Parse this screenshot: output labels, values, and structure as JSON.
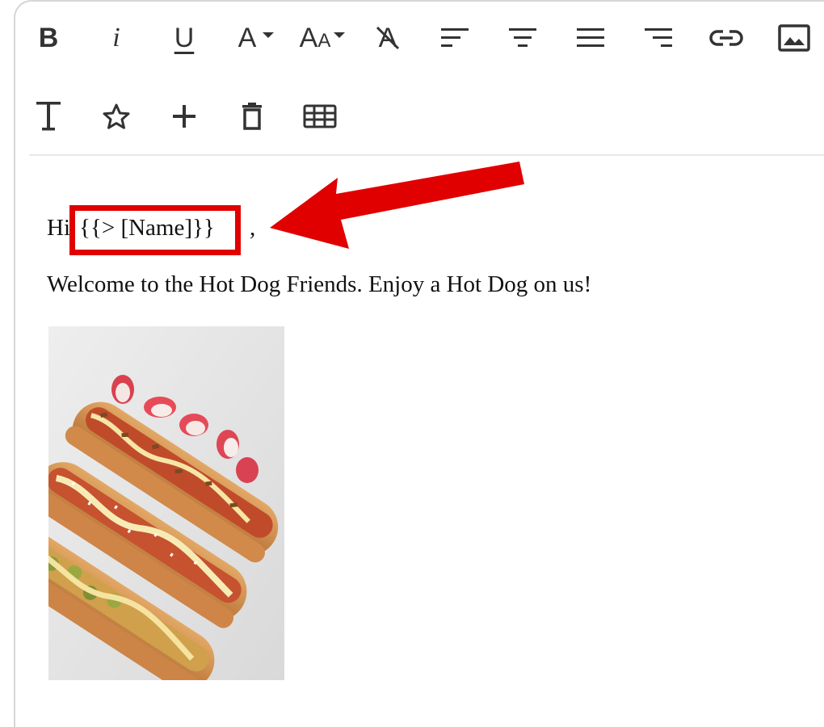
{
  "toolbar": {
    "row1": [
      {
        "name": "bold-button",
        "label": "B"
      },
      {
        "name": "italic-button",
        "label": "i"
      },
      {
        "name": "underline-button",
        "label": "U"
      },
      {
        "name": "font-color-button",
        "label": "A"
      },
      {
        "name": "font-size-button",
        "label": "AA"
      },
      {
        "name": "clear-format-button",
        "label": "A"
      },
      {
        "name": "align-left-button",
        "icon": "align-left-icon"
      },
      {
        "name": "align-center-button",
        "icon": "align-center-icon"
      },
      {
        "name": "align-justify-button",
        "icon": "align-justify-icon"
      },
      {
        "name": "align-right-button",
        "icon": "align-right-icon"
      },
      {
        "name": "insert-link-button",
        "icon": "link-icon"
      },
      {
        "name": "insert-image-button",
        "icon": "image-icon"
      }
    ],
    "row2": [
      {
        "name": "text-style-button",
        "icon": "text-icon"
      },
      {
        "name": "favorite-button",
        "icon": "star-icon"
      },
      {
        "name": "add-button",
        "icon": "plus-icon"
      },
      {
        "name": "delete-button",
        "icon": "trash-icon"
      },
      {
        "name": "insert-table-button",
        "icon": "table-icon"
      }
    ]
  },
  "editor": {
    "greeting_prefix": "Hi",
    "placeholder": "{{> [Name]}}",
    "greeting_suffix": ",",
    "welcome_text": "Welcome to the Hot Dog Friends. Enjoy a Hot Dog on us!",
    "image": "hot-dogs-photo"
  },
  "annotation": {
    "highlight_color": "#e00000"
  }
}
